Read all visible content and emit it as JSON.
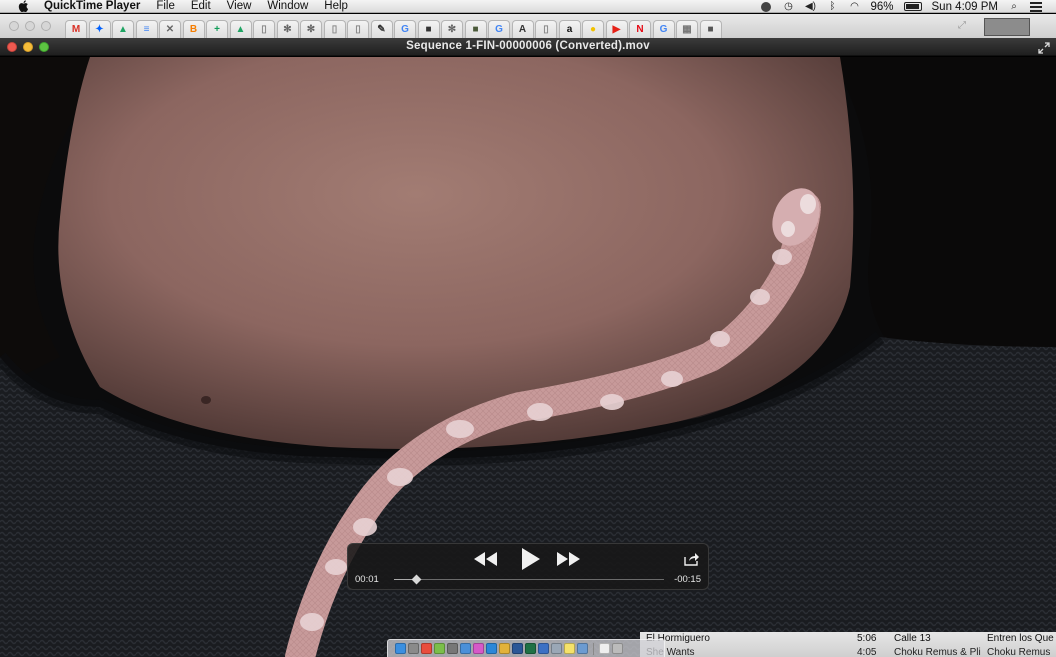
{
  "menubar": {
    "app_name": "QuickTime Player",
    "menus": [
      "File",
      "Edit",
      "View",
      "Window",
      "Help"
    ],
    "battery_percent": "96%",
    "clock": "Sun 4:09 PM",
    "status_icons": [
      "creative-cloud-icon",
      "time-machine-icon",
      "volume-icon",
      "bluetooth-icon",
      "wifi-icon"
    ]
  },
  "browser": {
    "tab_favicons": [
      {
        "name": "gmail-icon",
        "glyph": "M",
        "color": "#d93025"
      },
      {
        "name": "dropbox-icon",
        "glyph": "✦",
        "color": "#0061fe"
      },
      {
        "name": "google-drive-icon",
        "glyph": "▲",
        "color": "#1fa463"
      },
      {
        "name": "google-docs-icon",
        "glyph": "≡",
        "color": "#4285f4"
      },
      {
        "name": "close-tab-icon",
        "glyph": "✕",
        "color": "#666666"
      },
      {
        "name": "blogger-icon",
        "glyph": "B",
        "color": "#f57d00"
      },
      {
        "name": "google-sheets-icon",
        "glyph": "+",
        "color": "#0f9d58"
      },
      {
        "name": "google-drive-icon-2",
        "glyph": "▲",
        "color": "#1fa463"
      },
      {
        "name": "document-icon",
        "glyph": "▯",
        "color": "#888888"
      },
      {
        "name": "settings-icon",
        "glyph": "✻",
        "color": "#666666"
      },
      {
        "name": "settings-icon-2",
        "glyph": "✻",
        "color": "#666666"
      },
      {
        "name": "document-icon-2",
        "glyph": "▯",
        "color": "#888888"
      },
      {
        "name": "document-icon-3",
        "glyph": "▯",
        "color": "#888888"
      },
      {
        "name": "pin-icon",
        "glyph": "✎",
        "color": "#333333"
      },
      {
        "name": "google-icon",
        "glyph": "G",
        "color": "#4285f4"
      },
      {
        "name": "image-icon",
        "glyph": "■",
        "color": "#333333"
      },
      {
        "name": "settings-icon-3",
        "glyph": "✻",
        "color": "#666666"
      },
      {
        "name": "photo-thumb-icon",
        "glyph": "■",
        "color": "#4b5a3a"
      },
      {
        "name": "google-icon-2",
        "glyph": "G",
        "color": "#4285f4"
      },
      {
        "name": "tab-text-icon",
        "glyph": "A",
        "color": "#333333"
      },
      {
        "name": "document-icon-4",
        "glyph": "▯",
        "color": "#888888"
      },
      {
        "name": "amazon-icon",
        "glyph": "a",
        "color": "#111111"
      },
      {
        "name": "circle-yellow-icon",
        "glyph": "●",
        "color": "#f2c200"
      },
      {
        "name": "youtube-icon",
        "glyph": "▶",
        "color": "#e62117"
      },
      {
        "name": "netflix-icon",
        "glyph": "N",
        "color": "#e50914"
      },
      {
        "name": "google-icon-3",
        "glyph": "G",
        "color": "#4285f4"
      },
      {
        "name": "extension-icon",
        "glyph": "▦",
        "color": "#777777"
      },
      {
        "name": "jar-icon",
        "glyph": "■",
        "color": "#555555"
      }
    ]
  },
  "window": {
    "title": "Sequence 1-FIN-00000006 (Converted).mov"
  },
  "player": {
    "elapsed": "00:01",
    "remaining": "-00:15",
    "progress": 0.08
  },
  "itunes": {
    "rows": [
      {
        "title": "El Hormiguero",
        "time": "5:06",
        "artist": "Calle 13",
        "album": "Entren los Que"
      },
      {
        "title": "She Wants",
        "time": "4:05",
        "artist": "Choku Remus & Pli",
        "album": "Choku Remus"
      }
    ]
  },
  "dock": {
    "icons": [
      {
        "name": "finder-icon",
        "color": "#3b8fe0"
      },
      {
        "name": "system-preferences-icon",
        "color": "#8a8a8a"
      },
      {
        "name": "calendar-icon",
        "color": "#e94d3d"
      },
      {
        "name": "photos-icon",
        "color": "#7bbf4a"
      },
      {
        "name": "settings-dock-icon",
        "color": "#777777"
      },
      {
        "name": "mail-icon",
        "color": "#4a90d9"
      },
      {
        "name": "itunes-icon",
        "color": "#d659c8"
      },
      {
        "name": "safari-icon",
        "color": "#2a87d8"
      },
      {
        "name": "chrome-icon",
        "color": "#e2b23a"
      },
      {
        "name": "word-icon",
        "color": "#2b5797"
      },
      {
        "name": "excel-icon",
        "color": "#1e7145"
      },
      {
        "name": "quicktime-icon",
        "color": "#3b70c4"
      },
      {
        "name": "preview-icon",
        "color": "#9aa7b6"
      },
      {
        "name": "notes-icon",
        "color": "#f5e26a"
      },
      {
        "name": "downloads-icon",
        "color": "#6c9bd1"
      },
      {
        "name": "document-stack-icon",
        "color": "#eeeeee"
      },
      {
        "name": "trash-icon",
        "color": "#bbbbbb"
      }
    ]
  }
}
